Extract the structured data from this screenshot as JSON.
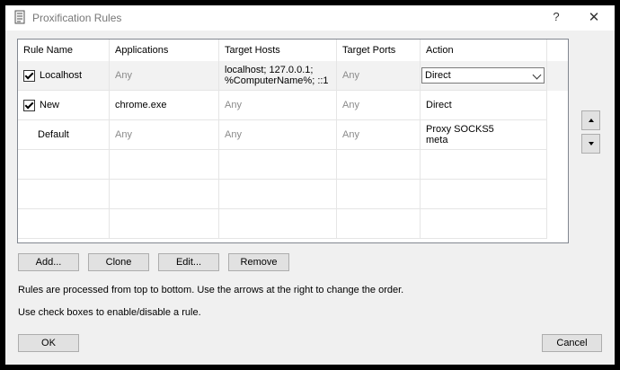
{
  "window": {
    "title": "Proxification Rules",
    "help": "?",
    "close": "✕"
  },
  "table": {
    "headers": [
      "Rule Name",
      "Applications",
      "Target Hosts",
      "Target Ports",
      "Action"
    ],
    "rows": [
      {
        "checked": true,
        "name": "Localhost",
        "applications": "Any",
        "hosts": "localhost; 127.0.0.1;\n%ComputerName%; ::1",
        "ports": "Any",
        "action": "Direct",
        "action_is_dropdown": true
      },
      {
        "checked": true,
        "name": "New",
        "applications": "chrome.exe",
        "hosts": "Any",
        "ports": "Any",
        "action": "Direct"
      },
      {
        "checked": false,
        "name": "Default",
        "applications": "Any",
        "hosts": "Any",
        "ports": "Any",
        "action": "Proxy SOCKS5\nmeta"
      }
    ]
  },
  "buttons": {
    "add": "Add...",
    "clone": "Clone",
    "edit": "Edit...",
    "remove": "Remove",
    "ok": "OK",
    "cancel": "Cancel"
  },
  "info": {
    "line1": "Rules are processed from top to bottom. Use the arrows at the right to change the order.",
    "line2": "Use check boxes to enable/disable a rule."
  }
}
